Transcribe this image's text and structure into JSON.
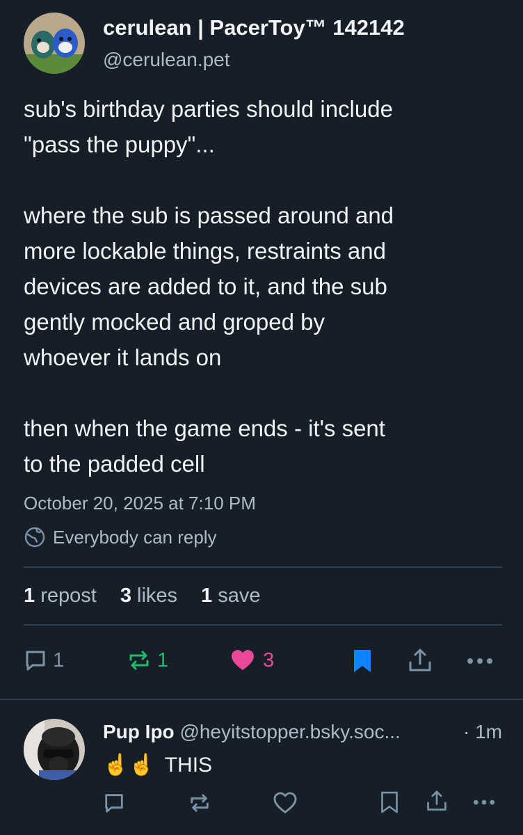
{
  "post": {
    "author": {
      "display_name": "cerulean | PacerToy™ 142142",
      "handle": "@cerulean.pet"
    },
    "lines": [
      "sub's birthday parties should include",
      "\"pass the puppy\"...",
      "",
      "where the sub is passed around and",
      "more lockable things, restraints and",
      "devices are added to it, and the sub",
      "gently mocked and groped by",
      "whoever it lands on",
      "",
      "then when the game ends - it's sent",
      "to the padded cell"
    ],
    "timestamp": "October 20, 2025 at 7:10 PM",
    "reply_setting": "Everybody can reply",
    "stats": {
      "reposts_num": "1",
      "reposts_label": "repost",
      "likes_num": "3",
      "likes_label": "likes",
      "saves_num": "1",
      "saves_label": "save"
    },
    "actions": {
      "reply_count": "1",
      "repost_count": "1",
      "like_count": "3"
    }
  },
  "reply": {
    "display_name": "Pup Ipo",
    "handle": "@heyitstopper.bsky.soc...",
    "time": "· 1m",
    "emoji": "☝☝",
    "text": "THIS"
  },
  "colors": {
    "background": "#161e27",
    "secondary_text": "#aebbc9",
    "icon": "#7d93a8",
    "repost_green": "#20bc6a",
    "like_pink": "#ec4899",
    "bookmark_blue": "#1083fe",
    "divider": "#2e4052"
  },
  "icons": [
    "reply-icon",
    "repost-icon",
    "heart-icon",
    "bookmark-icon",
    "share-icon",
    "more-icon",
    "globe-icon"
  ]
}
